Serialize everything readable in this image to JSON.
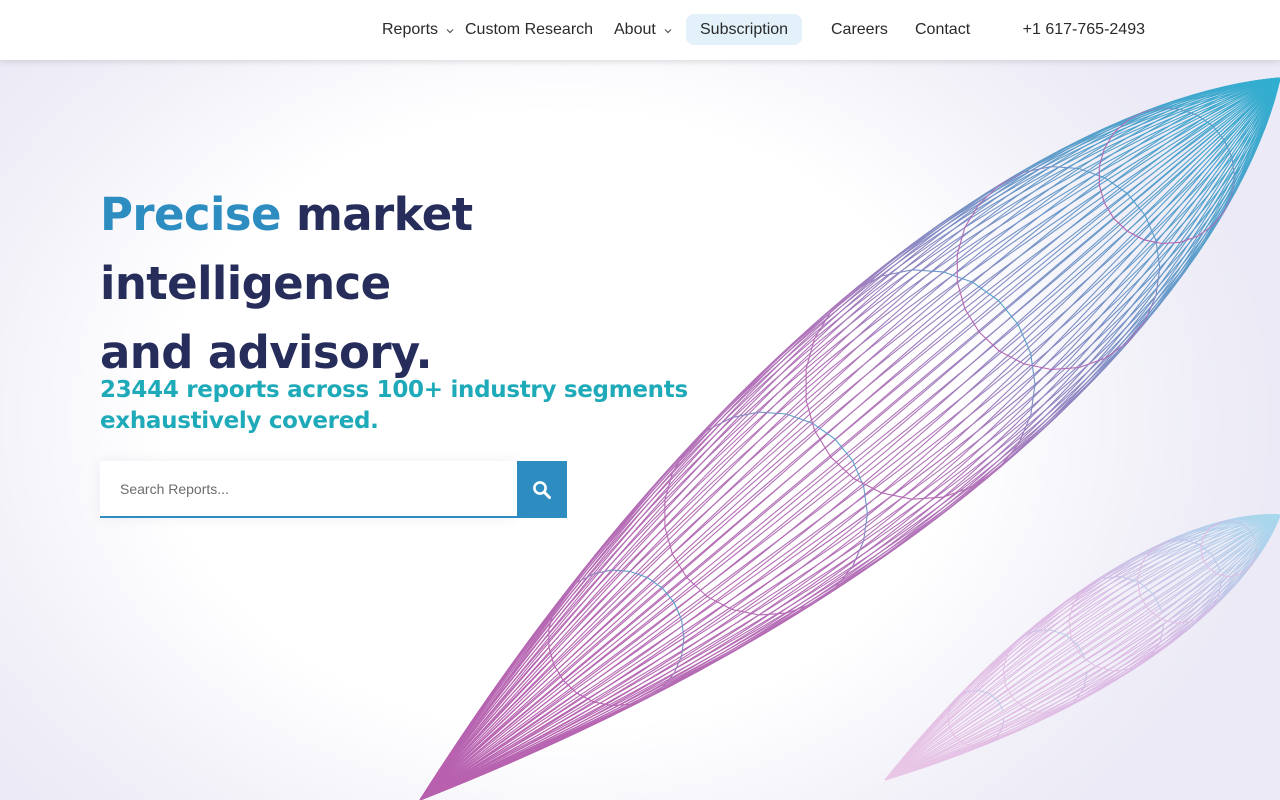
{
  "nav": {
    "items": [
      {
        "label": "Reports",
        "dropdown": true
      },
      {
        "label": "Custom Research",
        "dropdown": false
      },
      {
        "label": "About",
        "dropdown": true
      },
      {
        "label": "Subscription",
        "dropdown": false,
        "active": true
      },
      {
        "label": "Careers",
        "dropdown": false
      },
      {
        "label": "Contact",
        "dropdown": false
      }
    ],
    "phone": "+1 617-765-2493"
  },
  "hero": {
    "headline_accent": "Precise",
    "headline_rest_line1": " market intelligence",
    "headline_line2": "and advisory.",
    "subline": "23444 reports across 100+ industry segments exhaustively covered."
  },
  "search": {
    "placeholder": "Search Reports...",
    "button_icon": "search-icon"
  },
  "colors": {
    "accent_blue": "#2d8dc0",
    "navy": "#262d5b",
    "teal": "#1eaab8",
    "art_purple": "#b14fa6",
    "art_cyan": "#1ba9cc"
  }
}
